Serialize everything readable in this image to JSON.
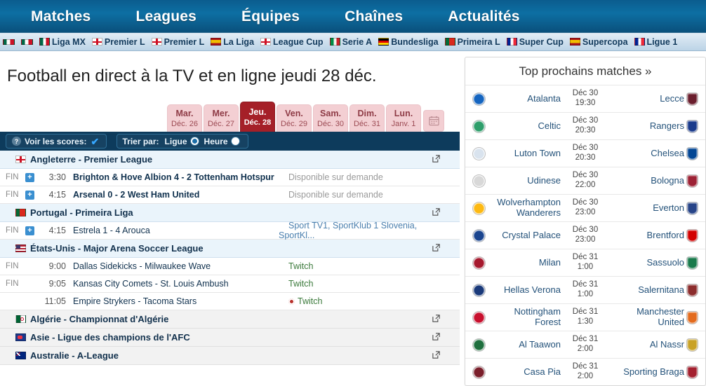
{
  "topnav": {
    "items": [
      {
        "label": "Matches"
      },
      {
        "label": "Leagues"
      },
      {
        "label": "Équipes"
      },
      {
        "label": "Chaînes"
      },
      {
        "label": "Actualités"
      }
    ]
  },
  "league_strip": {
    "items": [
      {
        "label": "",
        "flag": "partialmx"
      },
      {
        "label": "",
        "flag": "partialmx"
      },
      {
        "label": "Liga MX",
        "flag": "mx"
      },
      {
        "label": "Premier L",
        "flag": "eng"
      },
      {
        "label": "Premier L",
        "flag": "eng"
      },
      {
        "label": "La Liga",
        "flag": "es"
      },
      {
        "label": "League Cup",
        "flag": "eng"
      },
      {
        "label": "Serie A",
        "flag": "it"
      },
      {
        "label": "Bundesliga",
        "flag": "de"
      },
      {
        "label": "Primeira L",
        "flag": "pt"
      },
      {
        "label": "Super Cup",
        "flag": "fr"
      },
      {
        "label": "Supercopa",
        "flag": "es"
      },
      {
        "label": "Ligue 1",
        "flag": "fr"
      }
    ]
  },
  "page_title": "Football en direct à la TV et en ligne jeudi 28 déc.",
  "date_tabs": [
    {
      "day": "Mar.",
      "date": "Déc. 26",
      "active": false
    },
    {
      "day": "Mer.",
      "date": "Déc. 27",
      "active": false
    },
    {
      "day": "Jeu.",
      "date": "Déc. 28",
      "active": true
    },
    {
      "day": "Ven.",
      "date": "Déc. 29",
      "active": false
    },
    {
      "day": "Sam.",
      "date": "Déc. 30",
      "active": false
    },
    {
      "day": "Dim.",
      "date": "Déc. 31",
      "active": false
    },
    {
      "day": "Lun.",
      "date": "Janv. 1",
      "active": false
    }
  ],
  "calendar_button": {
    "icon": "calendar-icon"
  },
  "controls": {
    "scores_label": "Voir les scores:",
    "scores_checked": "✔",
    "help_icon": "?",
    "sort_label": "Trier par:",
    "sort_option_league": "Ligue",
    "sort_option_time": "Heure",
    "sort_selected": "Ligue"
  },
  "sections": [
    {
      "flag": "eng",
      "title": "Angleterre - Premier League",
      "type": "open",
      "matches": [
        {
          "status": "FIN",
          "plus": "+",
          "time": "3:30",
          "teams": "Brighton & Hove Albion 4 - 2 Tottenham Hotspur",
          "bold": true,
          "channel": "Disponible sur demande",
          "channel_style": "grey"
        },
        {
          "status": "FIN",
          "plus": "+",
          "time": "4:15",
          "teams": "Arsenal 0 - 2 West Ham United",
          "bold": true,
          "channel": "Disponible sur demande",
          "channel_style": "grey"
        }
      ]
    },
    {
      "flag": "pt",
      "title": "Portugal - Primeira Liga",
      "type": "open",
      "matches": [
        {
          "status": "FIN",
          "plus": "+",
          "time": "4:15",
          "teams": "Estrela 1 - 4 Arouca",
          "bold": false,
          "channel": "Sport TV1, SportKlub 1 Slovenia, SportKl...",
          "channel_style": "blue"
        }
      ]
    },
    {
      "flag": "us",
      "title": "États-Unis - Major Arena Soccer League",
      "type": "open",
      "matches": [
        {
          "status": "FIN",
          "plus": "",
          "time": "9:00",
          "teams": "Dallas Sidekicks - Milwaukee Wave",
          "bold": false,
          "channel": "Twitch",
          "channel_style": "green"
        },
        {
          "status": "FIN",
          "plus": "",
          "time": "9:05",
          "teams": "Kansas City Comets - St. Louis Ambush",
          "bold": false,
          "channel": "Twitch",
          "channel_style": "green"
        },
        {
          "status": "",
          "plus": "",
          "time": "11:05",
          "teams": "Empire Strykers - Tacoma Stars",
          "bold": false,
          "channel": "Twitch",
          "channel_style": "green-dot"
        }
      ]
    },
    {
      "flag": "dz",
      "title": "Algérie - Championnat d'Algérie",
      "type": "collapsed",
      "matches": []
    },
    {
      "flag": "afc",
      "title": "Asie - Ligue des champions de l'AFC",
      "type": "collapsed",
      "matches": []
    },
    {
      "flag": "au",
      "title": "Australie - A-League",
      "type": "collapsed",
      "matches": []
    }
  ],
  "sidebar": {
    "title": "Top prochains matches »",
    "matches": [
      {
        "home": "Atalanta",
        "away": "Lecce",
        "date": "Déc 30",
        "time": "19:30",
        "home_color": "#1565c0",
        "away_color": "#6b1f2e"
      },
      {
        "home": "Celtic",
        "away": "Rangers",
        "date": "Déc 30",
        "time": "20:30",
        "home_color": "#2e9e6b",
        "away_color": "#1a3b8c"
      },
      {
        "home": "Luton Town",
        "away": "Chelsea",
        "date": "Déc 30",
        "time": "20:30",
        "home_color": "#d9e3ee",
        "away_color": "#034694"
      },
      {
        "home": "Udinese",
        "away": "Bologna",
        "date": "Déc 30",
        "time": "22:00",
        "home_color": "#d8d8d8",
        "away_color": "#9d2235"
      },
      {
        "home": "Wolverhampton Wanderers",
        "away": "Everton",
        "date": "Déc 30",
        "time": "23:00",
        "home_color": "#fdb913",
        "away_color": "#274488"
      },
      {
        "home": "Crystal Palace",
        "away": "Brentford",
        "date": "Déc 30",
        "time": "23:00",
        "home_color": "#1b458f",
        "away_color": "#d20000"
      },
      {
        "home": "Milan",
        "away": "Sassuolo",
        "date": "Déc 31",
        "time": "1:00",
        "home_color": "#a6192e",
        "away_color": "#1a7a4c"
      },
      {
        "home": "Hellas Verona",
        "away": "Salernitana",
        "date": "Déc 31",
        "time": "1:00",
        "home_color": "#1a3a7a",
        "away_color": "#8c2d2d"
      },
      {
        "home": "Nottingham Forest",
        "away": "Manchester United",
        "date": "Déc 31",
        "time": "1:30",
        "home_color": "#c8102e",
        "away_color": "#e36b1e"
      },
      {
        "home": "Al Taawon",
        "away": "Al Nassr",
        "date": "Déc 31",
        "time": "2:00",
        "home_color": "#1f6f3e",
        "away_color": "#c9a227"
      },
      {
        "home": "Casa Pia",
        "away": "Sporting Braga",
        "date": "Déc 31",
        "time": "2:00",
        "home_color": "#7a1f2b",
        "away_color": "#a3202f"
      }
    ]
  }
}
